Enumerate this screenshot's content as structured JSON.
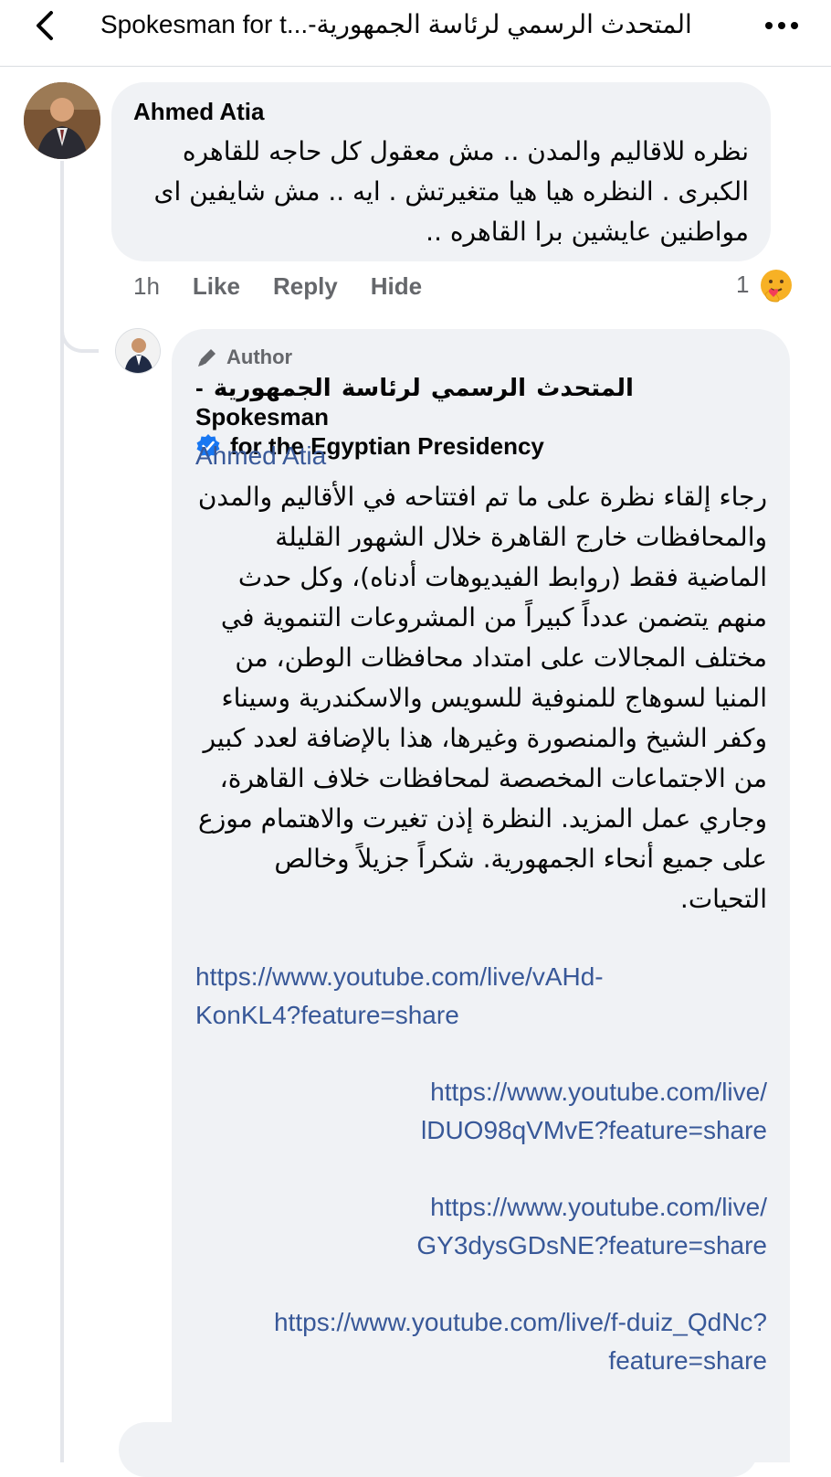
{
  "header": {
    "title": "Spokesman for t...-المتحدث الرسمي لرئاسة الجمهورية",
    "back_icon": "chevron-left-icon",
    "more_icon": "more-dots-icon"
  },
  "comment": {
    "author": "Ahmed Atia",
    "text": "نظره للاقاليم والمدن .. مش معقول كل حاجه للقاهره الكبرى . النظره هيا هيا متغيرتش . ايه .. مش شايفين اى مواطنين عايشين برا القاهره ..",
    "actions": {
      "time": "1h",
      "like": "Like",
      "reply": "Reply",
      "hide": "Hide"
    },
    "reaction_count": "1",
    "reaction_icon": "care-emoji-icon"
  },
  "reply": {
    "badge": "Author",
    "badge_icon": "pen-icon",
    "page_name_line1": "المتحدث الرسمي لرئاسة الجمهورية -Spokesman",
    "page_name_line2": "for the Egyptian Presidency",
    "verified_icon": "verified-badge-icon",
    "mention": "Ahmed Atia",
    "text": "رجاء إلقاء نظرة على ما تم افتتاحه في الأقاليم والمدن والمحافظات خارج القاهرة خلال الشهور القليلة الماضية فقط (روابط الفيديوهات أدناه)، وكل حدث منهم يتضمن عدداً كبيراً من المشروعات التنموية في مختلف المجالات على امتداد محافظات الوطن، من المنيا لسوهاج للمنوفية للسويس والاسكندرية وسيناء وكفر الشيخ والمنصورة وغيرها، هذا بالإضافة لعدد كبير من الاجتماعات المخصصة لمحافظات خلاف القاهرة، وجاري عمل المزيد. النظرة إذن تغيرت والاهتمام موزع على جميع أنحاء الجمهورية. شكراً جزيلاً وخالص التحيات.",
    "links": [
      {
        "line1": "https://www.youtube.com/live/vAHd-",
        "line2": "KonKL4?feature=share"
      },
      {
        "line1": "https://www.youtube.com/live/",
        "line2": "lDUO98qVMvE?feature=share"
      },
      {
        "line1": "https://www.youtube.com/live/",
        "line2": "GY3dysGDsNE?feature=share"
      },
      {
        "line1": "https://www.youtube.com/live/f-duiz_QdNc?",
        "line2": "feature=share"
      }
    ]
  },
  "colors": {
    "bubble": "#f0f2f5",
    "link": "#385898",
    "verified": "#1877f2",
    "secondary_text": "#65676b"
  }
}
